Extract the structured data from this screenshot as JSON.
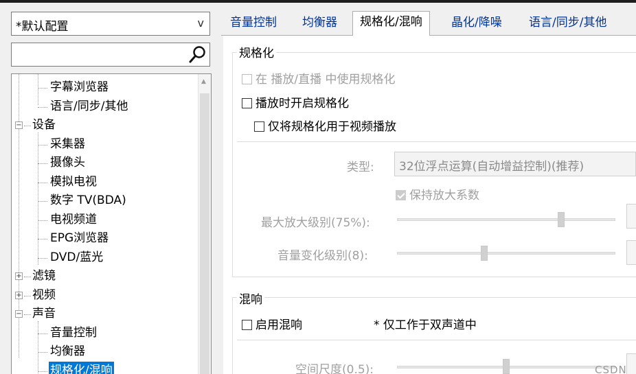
{
  "profile": {
    "selected": "*默认配置",
    "arrow": "v"
  },
  "search": {
    "value": ""
  },
  "tree": {
    "items": [
      "字幕浏览器",
      "语言/同步/其他",
      "设备",
      "采集器",
      "摄像头",
      "模拟电视",
      "数字 TV(BDA)",
      "电视频道",
      "EPG浏览器",
      "DVD/蓝光",
      "滤镜",
      "视频",
      "声音",
      "音量控制",
      "均衡器",
      "规格化/混响"
    ],
    "toggles": {
      "expanded": "−",
      "collapsed": "+"
    }
  },
  "tabs": [
    "音量控制",
    "均衡器",
    "规格化/混响",
    "晶化/降噪",
    "语言/同步/其他"
  ],
  "normalization": {
    "title": "规格化",
    "use_in_playback": "在 播放/直播 中使用规格化",
    "enable_on_playback": "播放时开启规格化",
    "video_only": "仅将规格化用于视频播放",
    "type_label": "类型:",
    "type_value": "32位浮点运算(自动增益控制)(推荐)",
    "keep_gain": "保持放大系数",
    "max_gain_label": "最大放大级别(75%):",
    "max_gain_value": 0.75,
    "volume_change_label": "音量变化级别(8):",
    "volume_change_value": 8
  },
  "reverb": {
    "title": "混响",
    "enable": "启用混响",
    "note": "* 仅工作于双声道中",
    "room_size_label": "空间尺度(0.5):",
    "room_size_value": 0.5
  },
  "watermark": "CSDN"
}
